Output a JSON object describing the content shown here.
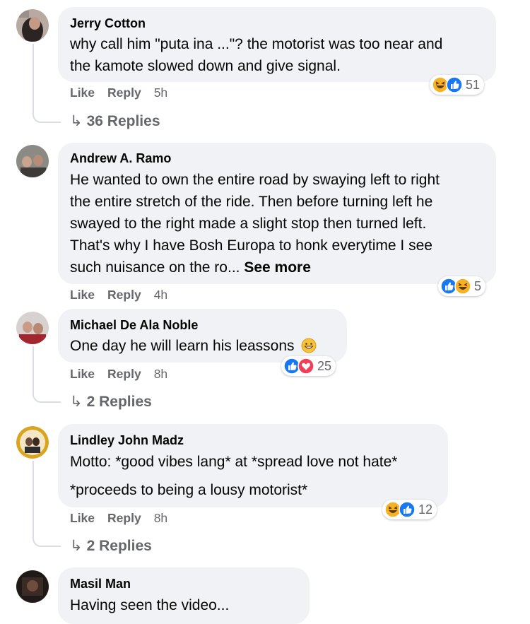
{
  "comments": [
    {
      "author": "Jerry Cotton",
      "lines": [
        "why call him \"puta ina ...\"? the motorist was too near and",
        "the kamote slowed down and give signal."
      ],
      "like": "Like",
      "reply": "Reply",
      "time": "5h",
      "reaction_count": "51",
      "replies_label": "36 Replies"
    },
    {
      "author": "Andrew A. Ramo",
      "lines": [
        "He wanted to own the entire road by swaying left to right",
        "the entire stretch of the ride. Then before turning left he",
        "swayed to the right made a slight stop then turned left.",
        "That's why I have Bosh Europa to honk everytime I see",
        "such nuisance on the ro..."
      ],
      "see_more": "See more",
      "like": "Like",
      "reply": "Reply",
      "time": "4h",
      "reaction_count": "5"
    },
    {
      "author": "Michael De Ala Noble",
      "lines": [
        "One day he will learn his leassons"
      ],
      "like": "Like",
      "reply": "Reply",
      "time": "8h",
      "reaction_count": "25",
      "replies_label": "2 Replies"
    },
    {
      "author": "Lindley John Madz",
      "lines": [
        "Motto: *good vibes lang* at *spread love not hate*",
        "*proceeds to being a lousy motorist*"
      ],
      "like": "Like",
      "reply": "Reply",
      "time": "8h",
      "reaction_count": "12",
      "replies_label": "2 Replies"
    },
    {
      "author": "Masil Man",
      "lines": [
        "Having seen the video..."
      ]
    }
  ],
  "colors": {
    "bubble": "#f0f2f5",
    "secondary_text": "#65676b",
    "like_blue": "#1877f2",
    "love_red": "#f33e58",
    "haha_yellow": "#f7b125"
  },
  "icons": [
    "reply-arrow-icon",
    "haha-reaction-icon",
    "like-reaction-icon",
    "love-reaction-icon",
    "grinning-emoji-icon"
  ]
}
